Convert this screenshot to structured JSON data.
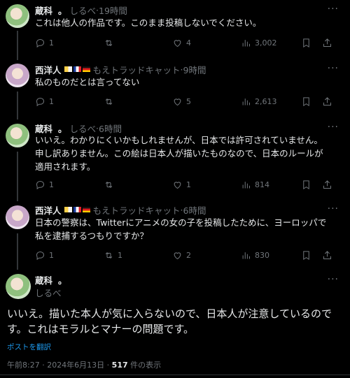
{
  "replies": [
    {
      "name": "蔵科",
      "dot": "。",
      "handle": "しるべ",
      "time": "19時間",
      "flags": false,
      "text": "これは他人の作品です。このまま投稿しないでください。",
      "reply_count": "1",
      "retweet_count": "",
      "like_count": "4",
      "view_count": "3,002"
    },
    {
      "name": "西洋人",
      "dot": "",
      "handle": "もえトラッドキャット",
      "time": "9時間",
      "flags": true,
      "text": "私のものだとは言ってない",
      "reply_count": "1",
      "retweet_count": "",
      "like_count": "5",
      "view_count": "2,613"
    },
    {
      "name": "蔵科",
      "dot": "。",
      "handle": "しるべ",
      "time": "6時間",
      "flags": false,
      "text": "いいえ。わかりにくいかもしれませんが、日本では許可されていません。申し訳ありません。この絵は日本人が描いたものなので、日本のルールが適用されます。",
      "reply_count": "1",
      "retweet_count": "",
      "like_count": "1",
      "view_count": "814"
    },
    {
      "name": "西洋人",
      "dot": "",
      "handle": "もえトラッドキャット",
      "time": "6時間",
      "flags": true,
      "text": "日本の警察は、Twitterにアニメの女の子を投稿したために、ヨーロッパで私を逮捕するつもりですか？",
      "reply_count": "1",
      "retweet_count": "1",
      "like_count": "2",
      "view_count": "830"
    }
  ],
  "main": {
    "name": "蔵科",
    "dot": "。",
    "handle": "しるべ",
    "text": "いいえ。描いた本人が気に入らないので、日本人が注意しているのです。これはモラルとマナーの問題です。",
    "translate": "ポストを翻訳",
    "time": "午前8:27 · 2024年6月13日 · ",
    "views": "517",
    "views_suffix": " 件の表示"
  },
  "sep": " · ",
  "more_label": "···"
}
